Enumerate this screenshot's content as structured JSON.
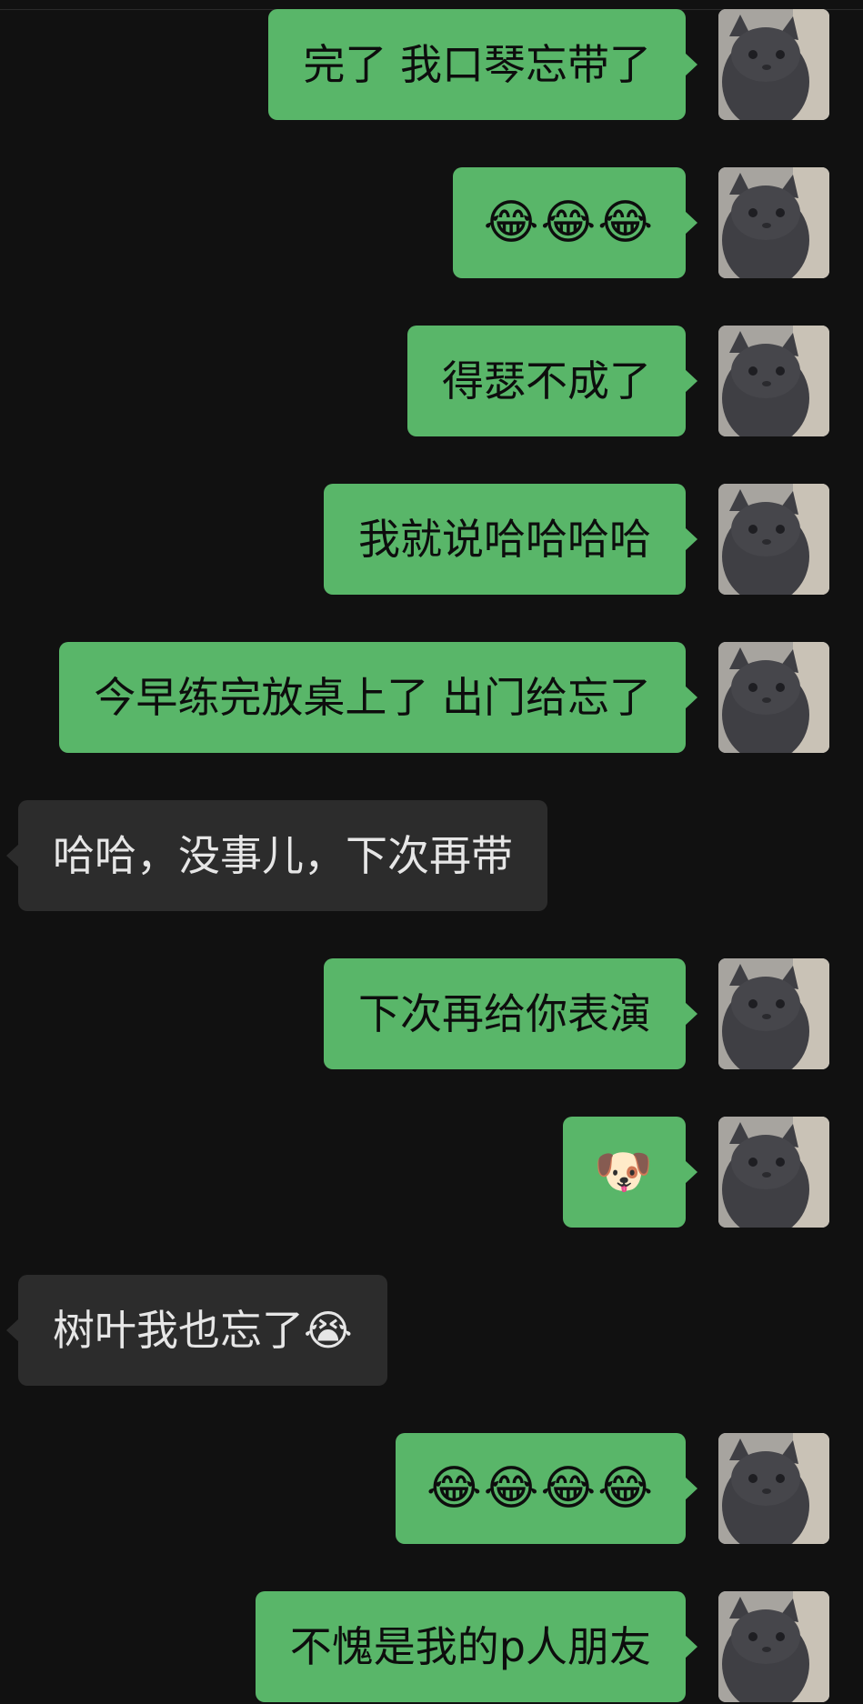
{
  "colors": {
    "background": "#111111",
    "outgoing_bubble": "#59b669",
    "incoming_bubble": "#2c2c2c",
    "outgoing_text": "#0d0d0d",
    "incoming_text": "#e6e6e6"
  },
  "avatar": {
    "icon": "gray-cat-avatar-icon"
  },
  "messages": [
    {
      "direction": "out",
      "text": "完了 我口琴忘带了"
    },
    {
      "direction": "out",
      "text": "😂😂😂"
    },
    {
      "direction": "out",
      "text": "得瑟不成了"
    },
    {
      "direction": "out",
      "text": "我就说哈哈哈哈"
    },
    {
      "direction": "out",
      "text": "今早练完放桌上了 出门给忘了"
    },
    {
      "direction": "in",
      "text": "哈哈，没事儿，下次再带"
    },
    {
      "direction": "out",
      "text": "下次再给你表演"
    },
    {
      "direction": "out",
      "text": "🐶"
    },
    {
      "direction": "in",
      "text": "树叶我也忘了😭"
    },
    {
      "direction": "out",
      "text": "😂😂😂😂"
    },
    {
      "direction": "out",
      "text": "不愧是我的p人朋友"
    }
  ]
}
